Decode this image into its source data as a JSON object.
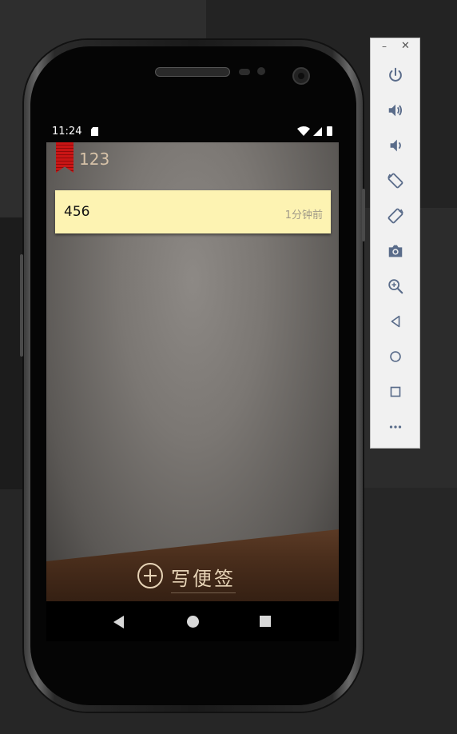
{
  "status_bar": {
    "time": "11:24"
  },
  "app": {
    "folder_title": "123",
    "notes": [
      {
        "text": "456",
        "time": "1分钟前"
      }
    ],
    "add_note_label": "写便签"
  },
  "emulator_toolbar": {
    "minimize_label": "–",
    "close_label": "✕",
    "buttons": [
      "power-icon",
      "volume-up-icon",
      "volume-down-icon",
      "rotate-left-icon",
      "rotate-right-icon",
      "camera-icon",
      "zoom-icon",
      "back-icon",
      "home-icon",
      "overview-icon",
      "more-icon"
    ]
  },
  "colors": {
    "note_background": "#fdf3b2",
    "bookmark": "#c91515",
    "folder_title": "#d7c2a8",
    "toolbar_icon": "#5a6c8a"
  }
}
